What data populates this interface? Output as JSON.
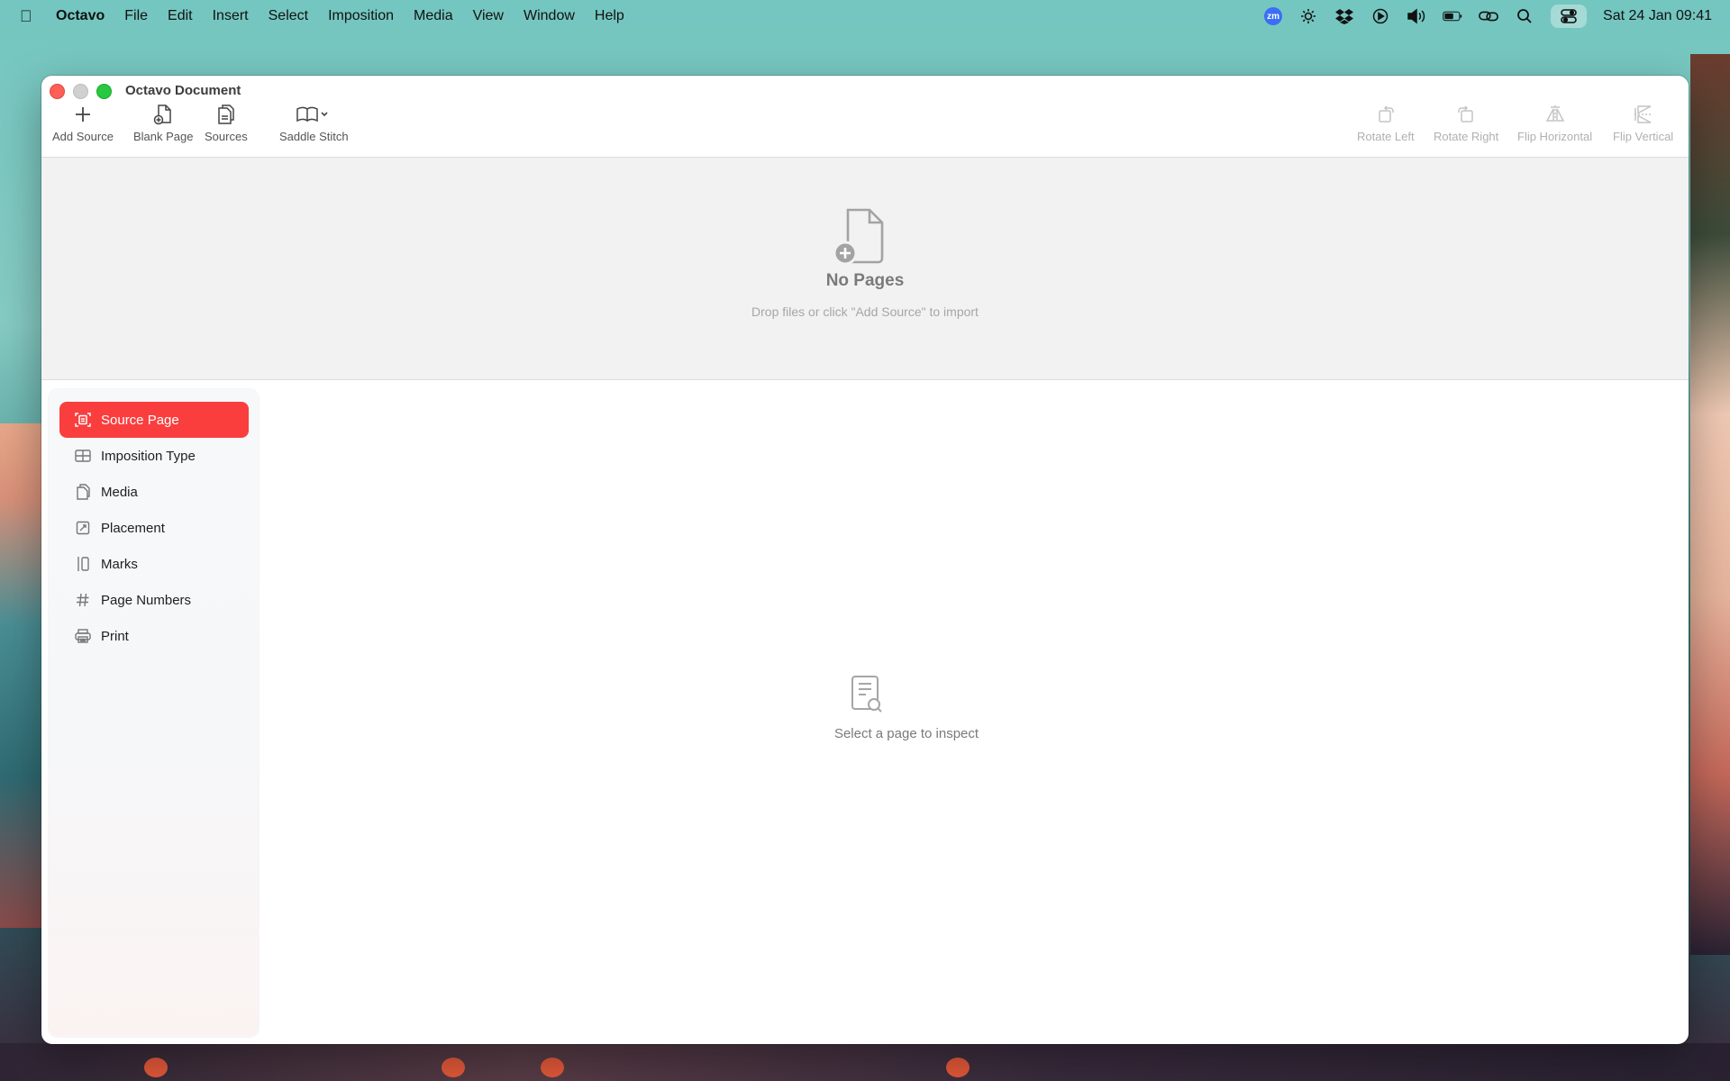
{
  "menubar": {
    "app_name": "Octavo",
    "items": [
      "File",
      "Edit",
      "Insert",
      "Select",
      "Imposition",
      "Media",
      "View",
      "Window",
      "Help"
    ],
    "zoom_badge": "zm",
    "datetime": "Sat 24 Jan  09:41"
  },
  "window": {
    "title": "Octavo Document"
  },
  "toolbar": {
    "add_source": "Add Source",
    "blank_page": "Blank Page",
    "sources": "Sources",
    "saddle_stitch": "Saddle Stitch",
    "rotate_left": "Rotate Left",
    "rotate_right": "Rotate Right",
    "flip_horizontal": "Flip Horizontal",
    "flip_vertical": "Flip Vertical"
  },
  "pages_area": {
    "title": "No Pages",
    "subtitle": "Drop files or click \"Add Source\" to import"
  },
  "sidebar": {
    "items": [
      {
        "label": "Source Page",
        "icon": "source-page-icon",
        "active": true
      },
      {
        "label": "Imposition Type",
        "icon": "grid-icon",
        "active": false
      },
      {
        "label": "Media",
        "icon": "media-icon",
        "active": false
      },
      {
        "label": "Placement",
        "icon": "placement-icon",
        "active": false
      },
      {
        "label": "Marks",
        "icon": "marks-icon",
        "active": false
      },
      {
        "label": "Page Numbers",
        "icon": "hash-icon",
        "active": false
      },
      {
        "label": "Print",
        "icon": "printer-icon",
        "active": false
      }
    ]
  },
  "inspector": {
    "empty_text": "Select a page to inspect"
  },
  "colors": {
    "accent": "#fa3e3e",
    "window_bg": "#ffffff",
    "pages_bg": "#f2f2f2"
  }
}
